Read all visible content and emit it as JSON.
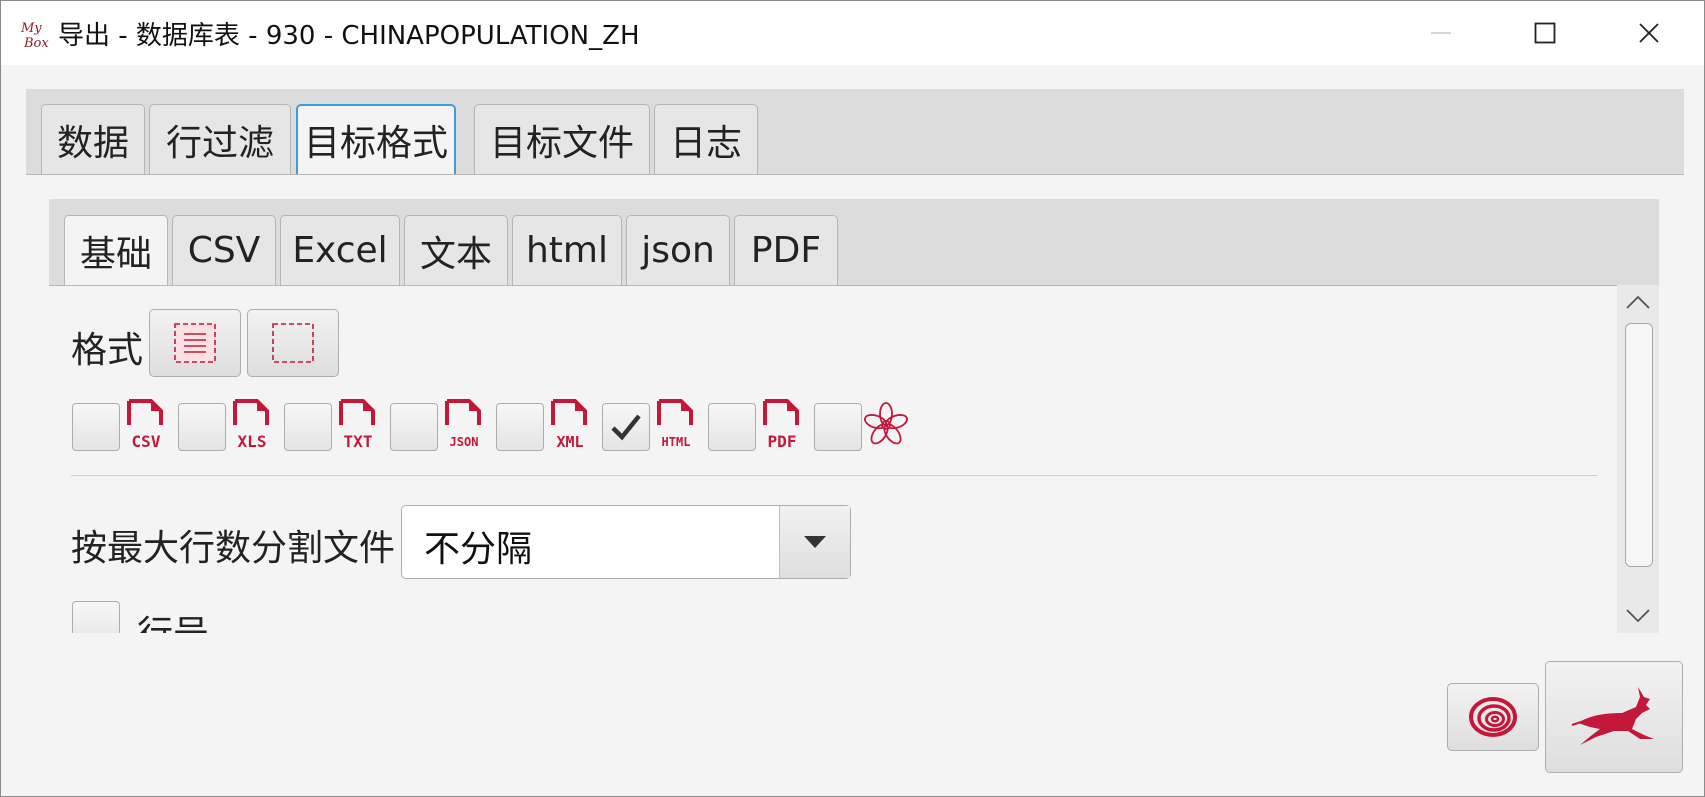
{
  "window": {
    "title": "导出 - 数据库表 - 930 - CHINAPOPULATION_ZH",
    "logo_text_top": "My",
    "logo_text_bottom": "Box",
    "controls": [
      "minimize-icon",
      "maximize-icon",
      "close-icon"
    ]
  },
  "outer_tabs": [
    {
      "label": "数据",
      "active": false
    },
    {
      "label": "行过滤",
      "active": false
    },
    {
      "label": "目标格式",
      "active": true
    },
    {
      "label": "目标文件",
      "active": false
    },
    {
      "label": "日志",
      "active": false
    }
  ],
  "inner_tabs": [
    {
      "label": "基础",
      "active": true
    },
    {
      "label": "CSV",
      "active": false
    },
    {
      "label": "Excel",
      "active": false
    },
    {
      "label": "文本",
      "active": false
    },
    {
      "label": "html",
      "active": false
    },
    {
      "label": "json",
      "active": false
    },
    {
      "label": "PDF",
      "active": false
    }
  ],
  "format": {
    "label": "格式",
    "buttons": [
      "select-all-icon",
      "select-none-icon"
    ],
    "options": [
      {
        "icon": "csv-file-icon",
        "text": "CSV",
        "checked": false
      },
      {
        "icon": "xls-file-icon",
        "text": "XLS",
        "checked": false
      },
      {
        "icon": "txt-file-icon",
        "text": "TXT",
        "checked": false
      },
      {
        "icon": "json-file-icon",
        "text": "JSON",
        "checked": false
      },
      {
        "icon": "xml-file-icon",
        "text": "XML",
        "checked": false
      },
      {
        "icon": "html-file-icon",
        "text": "HTML",
        "checked": true
      },
      {
        "icon": "pdf-file-icon",
        "text": "PDF",
        "checked": false
      },
      {
        "icon": "flower-icon",
        "text": "",
        "checked": false
      }
    ]
  },
  "split": {
    "label": "按最大行数分割文件",
    "value": "不分隔"
  },
  "row_number": {
    "label": "行号",
    "checked": false
  },
  "actions": [
    "clear-icon",
    "run-icon"
  ],
  "colors": {
    "accent": "#c3183a",
    "tab_focus": "#3a9ed8",
    "panel": "#dcdcdc",
    "background": "#f4f4f4"
  }
}
